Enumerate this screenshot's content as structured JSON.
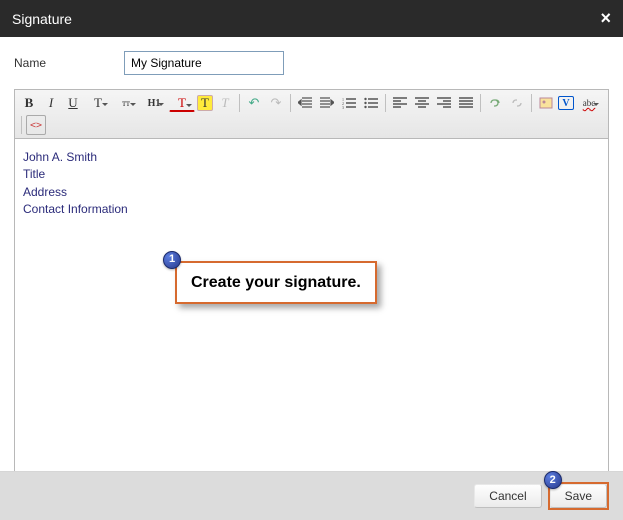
{
  "dialog": {
    "title": "Signature"
  },
  "field": {
    "name_label": "Name",
    "name_value": "My Signature"
  },
  "toolbar": {
    "bold": "B",
    "italic": "I",
    "underline": "U",
    "fontfamily": "T",
    "fontsize": "тт",
    "paragraph": "H1",
    "fontcolor": "T",
    "highlight": "T",
    "clearformat": "T",
    "undo": "↶",
    "redo": "↷",
    "outdent": "⇤",
    "indent": "⇥",
    "ol": "≡",
    "ul": "≡",
    "alignleft": "≡",
    "aligncenter": "≡",
    "alignright": "≡",
    "alignjust": "≡",
    "link": "⛓",
    "unlink": "⛓",
    "image": "▭",
    "vcard": "V",
    "spell": "abc",
    "source": "<>"
  },
  "signature": {
    "line1": "John A. Smith",
    "line2": "Title",
    "line3": "Address",
    "line4": "Contact Information"
  },
  "callout": {
    "c1_num": "1",
    "c1_text": "Create your signature.",
    "c2_num": "2"
  },
  "footer": {
    "cancel": "Cancel",
    "save": "Save"
  }
}
